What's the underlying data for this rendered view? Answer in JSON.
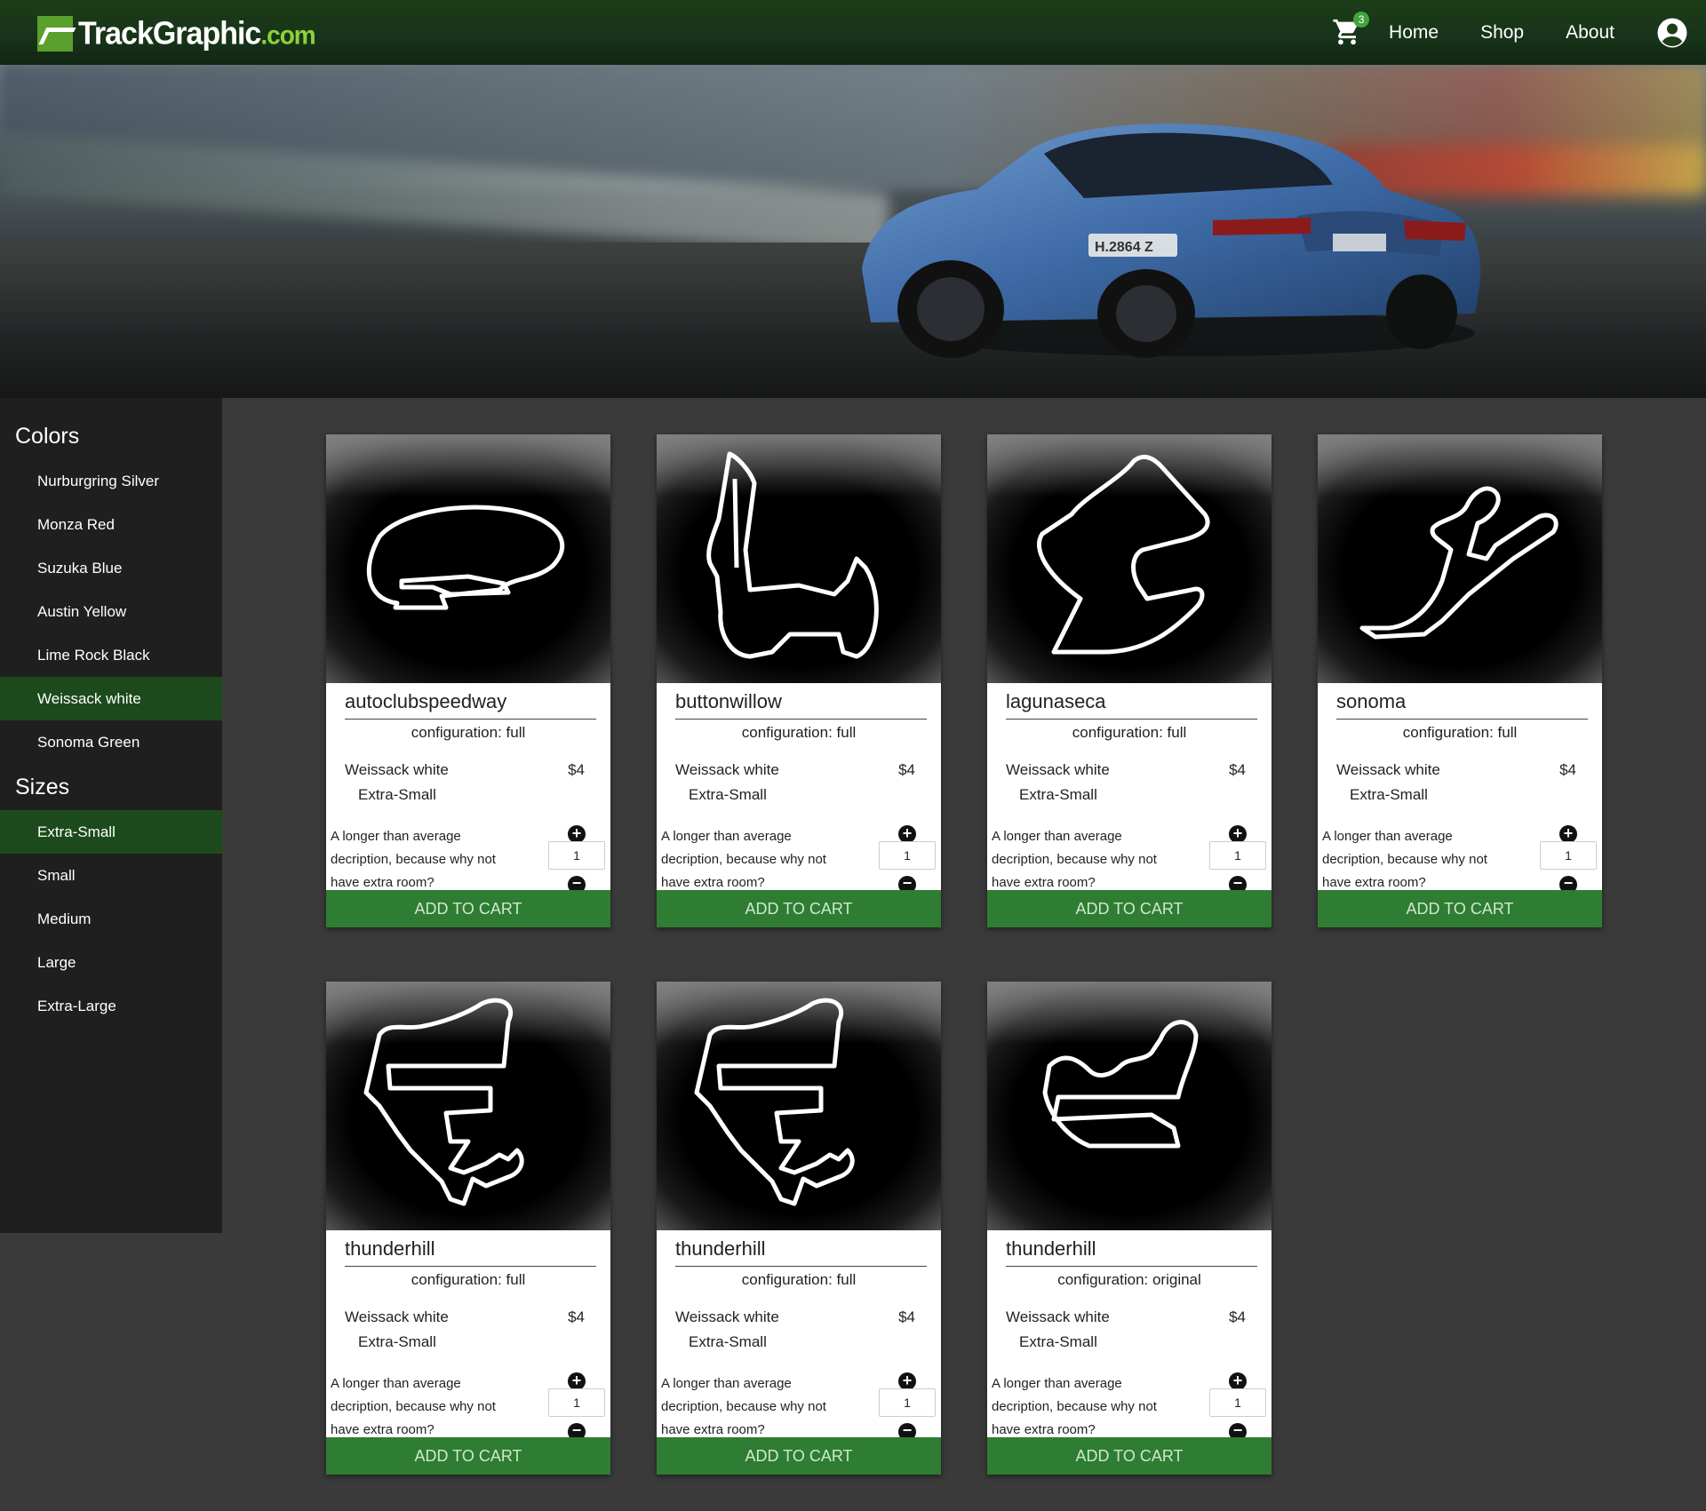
{
  "header": {
    "logo_main": "TrackGraphic",
    "logo_domain": ".com",
    "cart_count": "3",
    "nav": [
      "Home",
      "Shop",
      "About"
    ]
  },
  "sidebar": {
    "colors_heading": "Colors",
    "colors": [
      "Nurburgring Silver",
      "Monza Red",
      "Suzuka Blue",
      "Austin Yellow",
      "Lime Rock Black",
      "Weissack white",
      "Sonoma Green"
    ],
    "active_color": "Weissack white",
    "sizes_heading": "Sizes",
    "sizes": [
      "Extra-Small",
      "Small",
      "Medium",
      "Large",
      "Extra-Large"
    ],
    "active_size": "Extra-Small"
  },
  "products": [
    {
      "name": "autoclubspeedway",
      "configuration": "configuration: full",
      "color": "Weissack white",
      "price": "$4",
      "size": "Extra-Small",
      "description": "A longer than average decription, because why not have extra room?",
      "quantity": "1",
      "button": "ADD TO CART"
    },
    {
      "name": "buttonwillow",
      "configuration": "configuration: full",
      "color": "Weissack white",
      "price": "$4",
      "size": "Extra-Small",
      "description": "A longer than average decription, because why not have extra room?",
      "quantity": "1",
      "button": "ADD TO CART"
    },
    {
      "name": "lagunaseca",
      "configuration": "configuration: full",
      "color": "Weissack white",
      "price": "$4",
      "size": "Extra-Small",
      "description": "A longer than average decription, because why not have extra room?",
      "quantity": "1",
      "button": "ADD TO CART"
    },
    {
      "name": "sonoma",
      "configuration": "configuration: full",
      "color": "Weissack white",
      "price": "$4",
      "size": "Extra-Small",
      "description": "A longer than average decription, because why not have extra room?",
      "quantity": "1",
      "button": "ADD TO CART"
    },
    {
      "name": "thunderhill",
      "configuration": "configuration: full",
      "color": "Weissack white",
      "price": "$4",
      "size": "Extra-Small",
      "description": "A longer than average decription, because why not have extra room?",
      "quantity": "1",
      "button": "ADD TO CART"
    },
    {
      "name": "thunderhill",
      "configuration": "configuration: full",
      "color": "Weissack white",
      "price": "$4",
      "size": "Extra-Small",
      "description": "A longer than average decription, because why not have extra room?",
      "quantity": "1",
      "button": "ADD TO CART"
    },
    {
      "name": "thunderhill",
      "configuration": "configuration: original",
      "color": "Weissack white",
      "price": "$4",
      "size": "Extra-Small",
      "description": "A longer than average decription, because why not have extra room?",
      "quantity": "1",
      "button": "ADD TO CART"
    }
  ],
  "colors": {
    "header_bg": "#1d3d17",
    "accent_green": "#2e7d32",
    "sidebar_active": "#1c4a1c",
    "sidebar_bg": "#1f1f1f",
    "page_bg": "#3a3a3a"
  }
}
